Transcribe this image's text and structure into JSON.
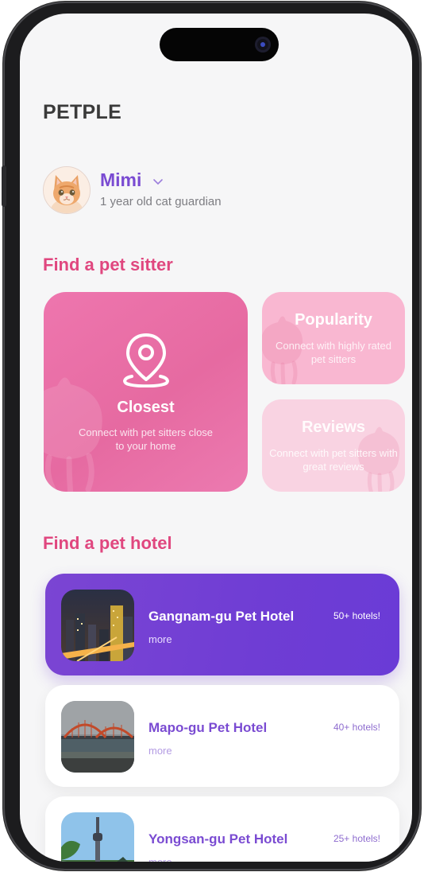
{
  "app": {
    "title": "PETPLE"
  },
  "profile": {
    "name": "Mimi",
    "description": "1 year old cat guardian",
    "dropdown_icon": "chevron-down-icon",
    "avatar_icon": "cat-avatar"
  },
  "sitter_section": {
    "title": "Find a pet sitter",
    "cards": [
      {
        "title": "Closest",
        "description": "Connect with pet sitters close to your home",
        "icon": "location-pin-icon"
      },
      {
        "title": "Popularity",
        "description": "Connect with highly rated pet sitters"
      },
      {
        "title": "Reviews",
        "description": "Connect with pet sitters with great reviews"
      }
    ]
  },
  "hotel_section": {
    "title": "Find a pet hotel",
    "hotels": [
      {
        "name": "Gangnam-gu Pet Hotel",
        "more": "more",
        "count": "50+ hotels!",
        "highlighted": true
      },
      {
        "name": "Mapo-gu Pet Hotel",
        "more": "more",
        "count": "40+ hotels!",
        "highlighted": false
      },
      {
        "name": "Yongsan-gu Pet Hotel",
        "more": "more",
        "count": "25+ hotels!",
        "highlighted": false
      }
    ]
  },
  "colors": {
    "brand_purple": "#7a4bd2",
    "section_pink": "#e0477f",
    "card_pink": "#e66aa1",
    "featured_purple": "#6f3dd4"
  }
}
